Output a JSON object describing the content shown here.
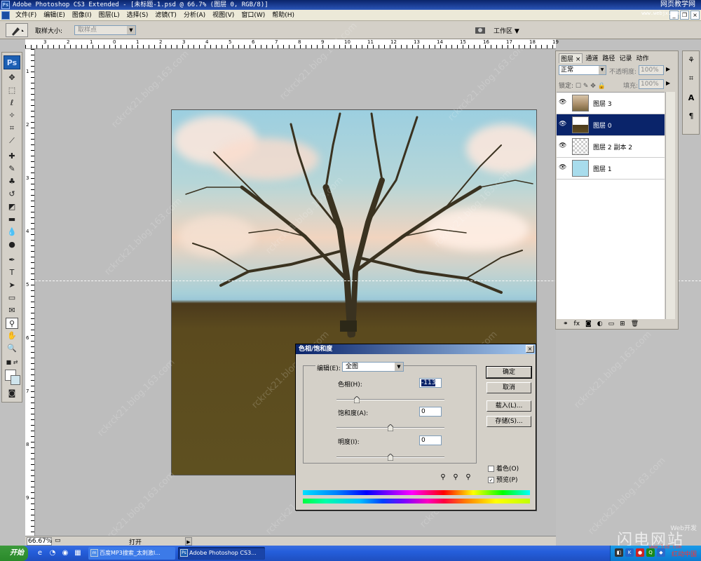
{
  "window": {
    "title": "Adobe Photoshop CS3 Extended - [未标题-1.psd @ 66.7% (图层 0, RGB/8)]",
    "brand": "网页教学网",
    "brand_url": "www.webjx.com"
  },
  "menu": [
    "文件(F)",
    "编辑(E)",
    "图像(I)",
    "图层(L)",
    "选择(S)",
    "滤镜(T)",
    "分析(A)",
    "视图(V)",
    "窗口(W)",
    "帮助(H)"
  ],
  "options": {
    "sample_size_label": "取样大小:",
    "sample_size_value": "取样点",
    "workspace_label": "工作区"
  },
  "rulers": {
    "top": [
      "3",
      "2",
      "1",
      "0",
      "1",
      "2",
      "3",
      "4",
      "5",
      "6",
      "7",
      "8",
      "9",
      "10",
      "11",
      "12",
      "13",
      "14",
      "15",
      "16",
      "17",
      "18",
      "19"
    ],
    "left": [
      "1",
      "2",
      "3",
      "4",
      "5",
      "6",
      "7",
      "8",
      "9"
    ]
  },
  "watermark": "rckrck21.blog.163.com",
  "layers_panel": {
    "tabs": [
      "图层 ×",
      "通道",
      "路径",
      "记录",
      "动作"
    ],
    "blend_mode": "正常",
    "opacity_label": "不透明度:",
    "opacity_value": "100%",
    "lock_label": "锁定:",
    "fill_label": "填充:",
    "fill_value": "100%",
    "layers": [
      {
        "name": "图层 3",
        "selected": false
      },
      {
        "name": "图层 0",
        "selected": true
      },
      {
        "name": "图层 2 副本 2",
        "selected": false
      },
      {
        "name": "图层 1",
        "selected": false
      }
    ]
  },
  "dialog": {
    "title": "色相/饱和度",
    "edit_label": "编辑(E):",
    "edit_value": "全图",
    "hue_label": "色相(H):",
    "hue_value": "-113",
    "saturation_label": "饱和度(A):",
    "saturation_value": "0",
    "lightness_label": "明度(I):",
    "lightness_value": "0",
    "hue_slider": -113,
    "saturation_slider": 0,
    "lightness_slider": 0,
    "ok": "确定",
    "cancel": "取消",
    "load": "载入(L)...",
    "save": "存储(S)...",
    "colorize_label": "着色(O)",
    "colorize_checked": false,
    "preview_label": "预览(P)",
    "preview_checked": true
  },
  "status": {
    "zoom": "66.67%",
    "doc_info": "打开"
  },
  "taskbar": {
    "start": "开始",
    "tasks": [
      "百度MP3搜索_太刺激I...",
      "Adobe Photoshop CS3..."
    ],
    "corner_top": "Web开发",
    "corner_wm": "闪电网站",
    "corner_bottom": "www.lsd.com",
    "tray_brand": "红动中国"
  }
}
